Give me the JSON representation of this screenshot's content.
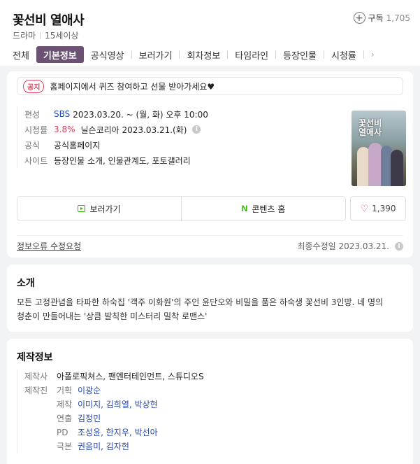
{
  "header": {
    "title": "꽃선비 열애사",
    "genre": "드라마",
    "rating": "15세이상",
    "subscribe_label": "구독",
    "subscribe_count": "1,705"
  },
  "tabs": [
    "전체",
    "기본정보",
    "공식영상",
    "보러가기",
    "회차정보",
    "타임라인",
    "등장인물",
    "시청률"
  ],
  "active_tab": "기본정보",
  "notice": {
    "badge": "공지",
    "text": "홈페이지에서 퀴즈 참여하고 선물 받아가세요♥"
  },
  "info": {
    "broadcast_label": "편성",
    "broadcast_channel": "SBS",
    "broadcast_schedule": "2023.03.20. ~ (월, 화) 오후 10:00",
    "ratings_label": "시청률",
    "ratings_value": "3.8%",
    "ratings_source": "닐슨코리아 2023.03.21.(화)",
    "official_label": "공식",
    "official_link": "공식홈페이지",
    "site_label": "사이트",
    "site_links": "등장인물 소개, 인물관계도, 포토갤러리",
    "poster_title": "꽃선비 열애사"
  },
  "actions": {
    "watch_label": "보러가기",
    "contents_label": "콘텐츠 홈",
    "like_count": "1,390"
  },
  "footer": {
    "report_label": "정보오류 수정요청",
    "updated_label": "최종수정일 2023.03.21."
  },
  "intro": {
    "title": "소개",
    "text": "모든 고정관념을 타파한 하숙집 '객주 이화원'의 주인 윤단오와 비밀을 품은 하숙생 꽃선비 3인방. 네 명의 청춘이 만들어내는 '상큼 발칙한 미스터리 밀착 로맨스'"
  },
  "production": {
    "title": "제작정보",
    "company_label": "제작사",
    "company_value": "아폴로픽쳐스, 팬엔터테인먼트, 스튜디오S",
    "staff_label": "제작진",
    "roles": [
      {
        "label": "기획",
        "value": "이광순"
      },
      {
        "label": "제작",
        "value": "이미지, 김희열, 박상현"
      },
      {
        "label": "연출",
        "value": "김정민"
      },
      {
        "label": "PD",
        "value": "조성윤, 한지우, 박선아"
      },
      {
        "label": "극본",
        "value": "권음미, 김자현"
      }
    ]
  },
  "colors": {
    "accent": "#6b5272",
    "link": "#2a4bb0",
    "highlight": "#e0415e",
    "naver_green": "#2db400"
  }
}
